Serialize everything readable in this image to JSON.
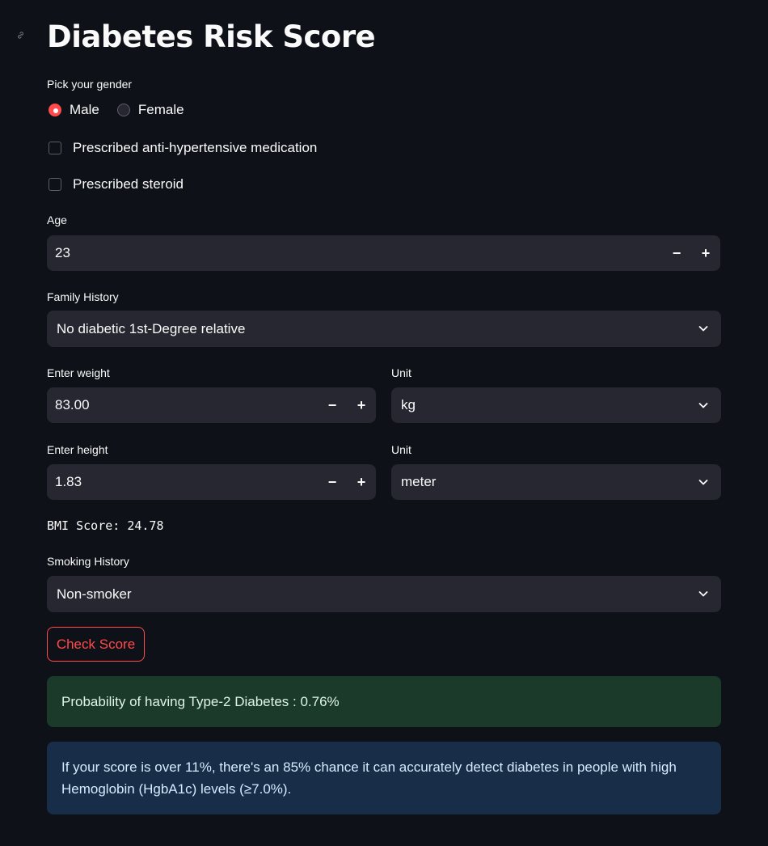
{
  "title": "Diabetes Risk Score",
  "gender": {
    "label": "Pick your gender",
    "options": [
      "Male",
      "Female"
    ],
    "selected": "Male"
  },
  "checkboxes": [
    {
      "label": "Prescribed anti-hypertensive medication",
      "checked": false
    },
    {
      "label": "Prescribed steroid",
      "checked": false
    }
  ],
  "age": {
    "label": "Age",
    "value": "23",
    "decrement": "−",
    "increment": "+"
  },
  "family_history": {
    "label": "Family History",
    "value": "No diabetic 1st-Degree relative"
  },
  "weight": {
    "label": "Enter weight",
    "value": "83.00",
    "decrement": "−",
    "increment": "+"
  },
  "weight_unit": {
    "label": "Unit",
    "value": "kg"
  },
  "height": {
    "label": "Enter height",
    "value": "1.83",
    "decrement": "−",
    "increment": "+"
  },
  "height_unit": {
    "label": "Unit",
    "value": "meter"
  },
  "bmi_text": "BMI Score: 24.78",
  "smoking": {
    "label": "Smoking History",
    "value": "Non-smoker"
  },
  "check_button": "Check Score",
  "result_text": "Probability of having Type-2 Diabetes : 0.76%",
  "info_text": "If your score is over 11%, there's an 85% chance it can accurately detect diabetes in people with high Hemoglobin (HgbA1c) levels (≥7.0%).",
  "colors": {
    "background": "#0e1117",
    "input": "#262730",
    "accent": "#ff4b4b",
    "success_bg": "#1b3a2a",
    "info_bg": "#172d48"
  }
}
